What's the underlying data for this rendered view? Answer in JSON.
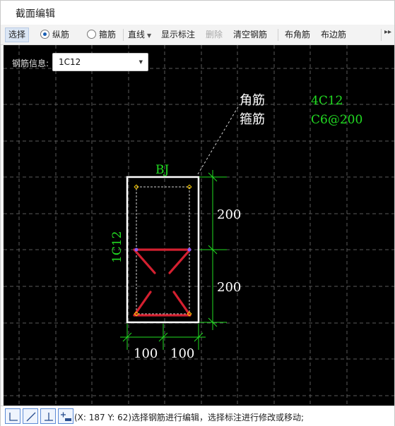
{
  "window": {
    "title": "截面编辑"
  },
  "toolbar": {
    "select": "选择",
    "longitudinal": "纵筋",
    "stirrup": "箍筋",
    "line_mode": "直线",
    "show_annotation": "显示标注",
    "delete": "删除",
    "clear_rebar": "清空钢筋",
    "corner_rebar": "布角筋",
    "side_rebar": "布边筋",
    "overflow": "▸▸"
  },
  "rebar_info": {
    "label": "钢筋信息:",
    "value": "1C12"
  },
  "drawing": {
    "corner_label": "角筋",
    "corner_value": "4C12",
    "stirrup_label": "箍筋",
    "stirrup_value": "C6@200",
    "section_name": "BJ",
    "side_rebar_label": "1C12",
    "dim_right_upper": "200",
    "dim_right_lower": "200",
    "dim_bottom_left": "100",
    "dim_bottom_right": "100",
    "colors": {
      "green": "#22dd22",
      "white": "#ffffff",
      "red": "#d42030",
      "yellow": "#ffd000",
      "grid": "#5a5a5a"
    }
  },
  "statusbar": {
    "text": "(X: 187 Y: 62)选择钢筋进行编辑，选择标注进行修改或移动;",
    "tools": [
      "orthogonal-icon",
      "slope-line-icon",
      "perpendicular-icon",
      "add-line-icon"
    ]
  }
}
